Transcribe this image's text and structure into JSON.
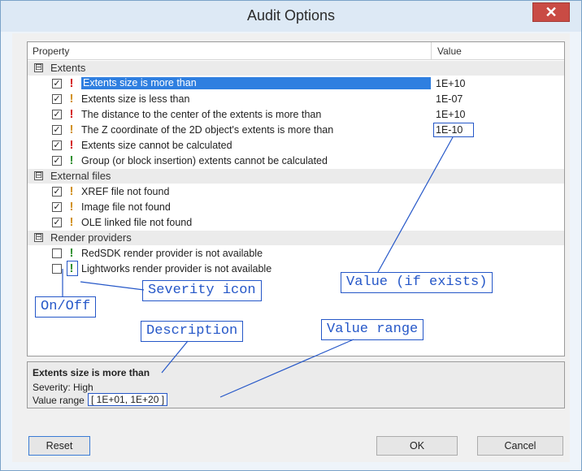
{
  "window": {
    "title": "Audit Options",
    "close_glyph": "✕"
  },
  "grid": {
    "headers": {
      "property": "Property",
      "value": "Value"
    },
    "groups": [
      {
        "label": "Extents",
        "expander": "⊟"
      },
      {
        "label": "External files",
        "expander": "⊟"
      },
      {
        "label": "Render providers",
        "expander": "⊟"
      }
    ],
    "rows": [
      {
        "checked": "✓",
        "severity": "high",
        "severity_glyph": "!",
        "label": "Extents size is more than",
        "value": "1E+10"
      },
      {
        "checked": "✓",
        "severity": "medium",
        "severity_glyph": "!",
        "label": "Extents size is less than",
        "value": "1E-07"
      },
      {
        "checked": "✓",
        "severity": "high",
        "severity_glyph": "!",
        "label": "The distance to the center of the extents is more than",
        "value": "1E+10"
      },
      {
        "checked": "✓",
        "severity": "medium",
        "severity_glyph": "!",
        "label": "The Z coordinate of the 2D object's extents is more than",
        "value": "1E-10"
      },
      {
        "checked": "✓",
        "severity": "high",
        "severity_glyph": "!",
        "label": "Extents size cannot be calculated",
        "value": ""
      },
      {
        "checked": "✓",
        "severity": "low",
        "severity_glyph": "!",
        "label": "Group (or block insertion) extents cannot be calculated",
        "value": ""
      },
      {
        "checked": "✓",
        "severity": "medium",
        "severity_glyph": "!",
        "label": "XREF file not found",
        "value": ""
      },
      {
        "checked": "✓",
        "severity": "medium",
        "severity_glyph": "!",
        "label": "Image file not found",
        "value": ""
      },
      {
        "checked": "✓",
        "severity": "medium",
        "severity_glyph": "!",
        "label": "OLE linked file not found",
        "value": ""
      },
      {
        "checked": "",
        "severity": "low",
        "severity_glyph": "!",
        "label": "RedSDK render provider is not available",
        "value": ""
      },
      {
        "checked": "",
        "severity": "low",
        "severity_glyph": "!",
        "label": "Lightworks render provider is not available",
        "value": ""
      }
    ]
  },
  "annotations": {
    "severity_icon": "Severity icon",
    "value_if_exists": "Value (if exists)",
    "on_off": "On/Off",
    "description": "Description",
    "value_range": "Value range"
  },
  "info": {
    "title": "Extents size is more than",
    "severity": "Severity: High",
    "range_label": "Value range",
    "range_value": "[ 1E+01, 1E+20 ]"
  },
  "buttons": {
    "reset": "Reset",
    "ok": "OK",
    "cancel": "Cancel"
  },
  "colors": {
    "severity_high": "#d42020",
    "severity_medium": "#d1901f",
    "severity_low": "#2e8f2e",
    "selection": "#2f7fe0",
    "annotation": "#2557c8"
  }
}
